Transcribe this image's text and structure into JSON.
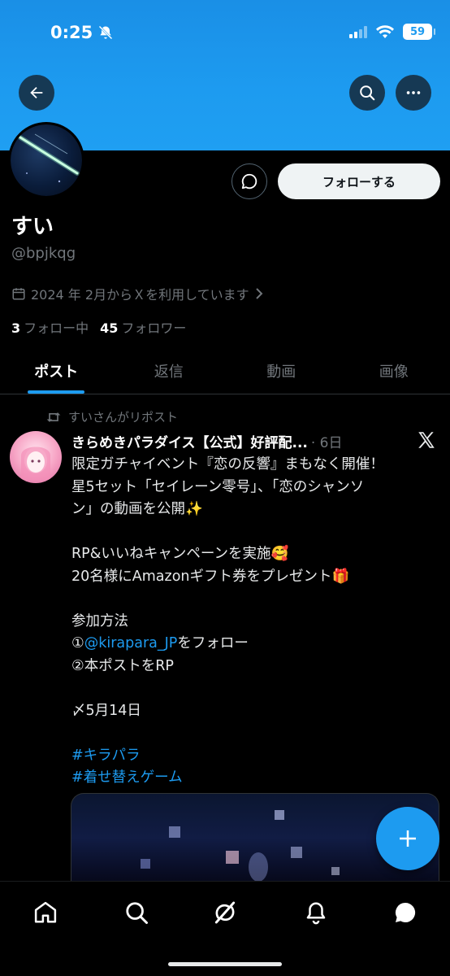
{
  "status_bar": {
    "time": "0:25",
    "battery": "59"
  },
  "profile": {
    "name": "すい",
    "handle": "@bpjkqg",
    "joined": "2024 年 2月からＸを利用しています",
    "following_count": "3",
    "following_label": "フォロー中",
    "followers_count": "45",
    "followers_label": "フォロワー",
    "follow_button": "フォローする"
  },
  "tabs": [
    {
      "label": "ポスト",
      "active": true
    },
    {
      "label": "返信",
      "active": false
    },
    {
      "label": "動画",
      "active": false
    },
    {
      "label": "画像",
      "active": false
    }
  ],
  "post": {
    "repost_text": "すいさんがリポスト",
    "author": "きらめきパラダイス【公式】好評配...",
    "time": "· 6日",
    "lines": {
      "l1": "限定ガチャイベント『恋の反響』まもなく開催！",
      "l2": "星5セット「セイレーン零号」、「恋のシャンソ",
      "l3": "ン」の動画を公開✨",
      "l4": "RP&いいねキャンペーンを実施🥰",
      "l5": "20名様にAmazonギフト券をプレゼント🎁",
      "l6": "参加方法",
      "l7_prefix": "①",
      "l7_mention": "@kirapara_JP",
      "l7_suffix": "をフォロー",
      "l8": "②本ポストをRP",
      "l9": "〆5月14日",
      "tag1": "#キラパラ",
      "tag2": "#着せ替えゲーム"
    }
  },
  "colors": {
    "accent": "#1d9bf0",
    "banner": "#1d9bf0",
    "muted": "#71767b"
  },
  "icons": [
    "back-arrow-icon",
    "search-icon",
    "more-icon",
    "message-icon",
    "calendar-icon",
    "chevron-right-icon",
    "repost-icon",
    "x-logo-icon",
    "plus-icon",
    "home-icon",
    "explore-icon",
    "grok-icon",
    "notifications-icon",
    "messages-icon"
  ]
}
